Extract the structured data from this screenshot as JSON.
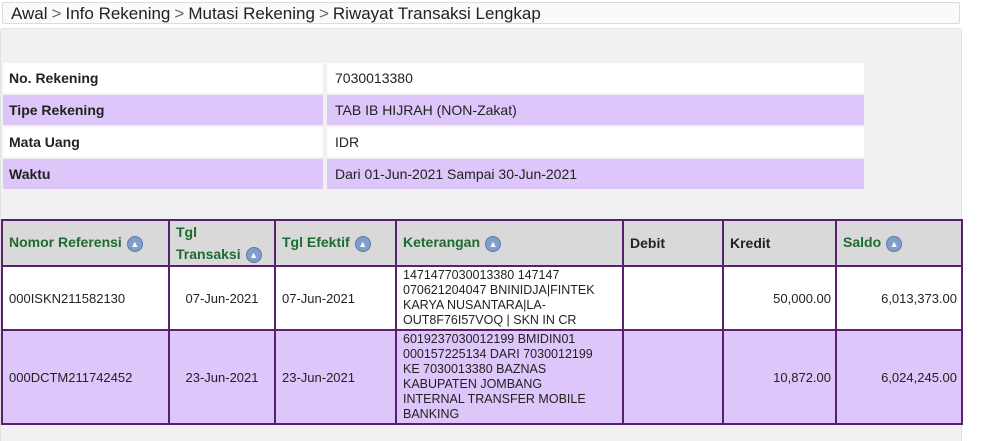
{
  "breadcrumb": {
    "items": [
      "Awal",
      "Info Rekening",
      "Mutasi Rekening",
      "Riwayat Transaksi Lengkap"
    ],
    "separator": ">"
  },
  "account_info": [
    {
      "label": "No. Rekening",
      "value": "7030013380"
    },
    {
      "label": "Tipe Rekening",
      "value": "TAB IB HIJRAH (NON-Zakat)"
    },
    {
      "label": "Mata Uang",
      "value": "IDR"
    },
    {
      "label": "Waktu",
      "value": "Dari 01-Jun-2021 Sampai 30-Jun-2021"
    }
  ],
  "table": {
    "headers": {
      "ref": "Nomor Referensi",
      "tgl_transaksi_1": "Tgl",
      "tgl_transaksi_2": "Transaksi",
      "tgl_efektif": "Tgl Efektif",
      "keterangan": "Keterangan",
      "debit": "Debit",
      "kredit": "Kredit",
      "saldo": "Saldo"
    },
    "rows": [
      {
        "ref": "000ISKN211582130",
        "tgl_transaksi": "07-Jun-2021",
        "tgl_efektif": "07-Jun-2021",
        "keterangan": [
          "1471477030013380 147147",
          "070621204047 BNINIDJA|FINTEK",
          "KARYA NUSANTARA|LA-",
          "OUT8F76I57VOQ | SKN IN CR"
        ],
        "debit": "",
        "kredit": "50,000.00",
        "saldo": "6,013,373.00"
      },
      {
        "ref": "000DCTM211742452",
        "tgl_transaksi": "23-Jun-2021",
        "tgl_efektif": "23-Jun-2021",
        "keterangan": [
          "6019237030012199 BMIDIN01",
          "000157225134 DARI 7030012199",
          "KE 7030013380 BAZNAS",
          "KABUPATEN JOMBANG",
          "INTERNAL TRANSFER MOBILE",
          "BANKING"
        ],
        "debit": "",
        "kredit": "10,872.00",
        "saldo": "6,024,245.00"
      }
    ]
  }
}
